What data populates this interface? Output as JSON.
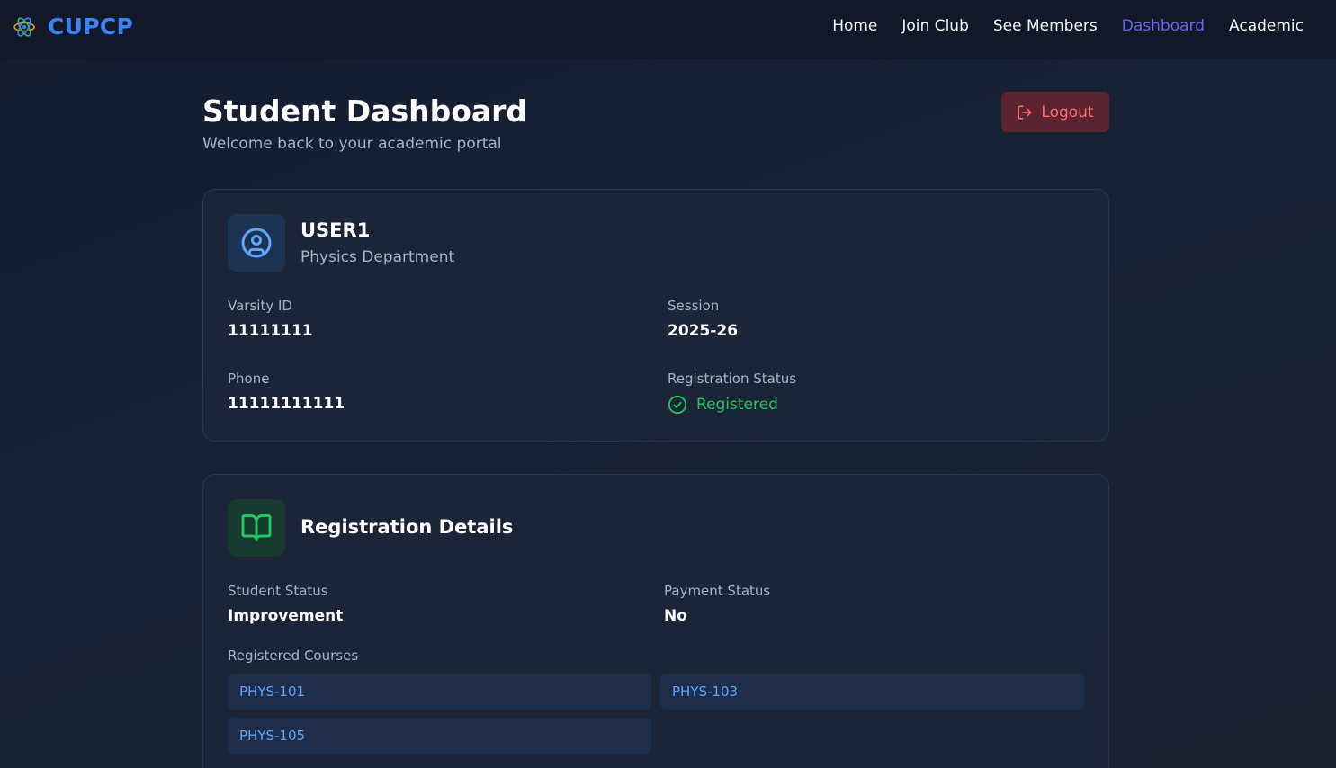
{
  "brand": {
    "name": "CUPCP",
    "logo_icon": "atom-icon"
  },
  "nav": {
    "items": [
      {
        "label": "Home",
        "active": false
      },
      {
        "label": "Join Club",
        "active": false
      },
      {
        "label": "See Members",
        "active": false
      },
      {
        "label": "Dashboard",
        "active": true
      },
      {
        "label": "Academic",
        "active": false
      }
    ]
  },
  "header": {
    "title": "Student Dashboard",
    "subtitle": "Welcome back to your academic portal",
    "logout_label": "Logout",
    "logout_icon": "logout-icon"
  },
  "profile": {
    "icon": "user-circle-icon",
    "name": "USER1",
    "department": "Physics Department",
    "varsity_id_label": "Varsity ID",
    "varsity_id": "11111111",
    "session_label": "Session",
    "session": "2025-26",
    "phone_label": "Phone",
    "phone": "11111111111",
    "registration_status_label": "Registration Status",
    "registration_status": "Registered",
    "registration_status_icon": "check-circle-icon"
  },
  "registration": {
    "icon": "book-open-icon",
    "heading": "Registration Details",
    "student_status_label": "Student Status",
    "student_status": "Improvement",
    "payment_status_label": "Payment Status",
    "payment_status": "No",
    "courses_label": "Registered Courses",
    "courses": [
      "PHYS-101",
      "PHYS-103",
      "PHYS-105"
    ]
  },
  "colors": {
    "accent": "#3b82f6",
    "nav_active": "#6366f1",
    "success": "#22c55e",
    "danger": "#f87171",
    "course_text": "#60a5fa"
  }
}
